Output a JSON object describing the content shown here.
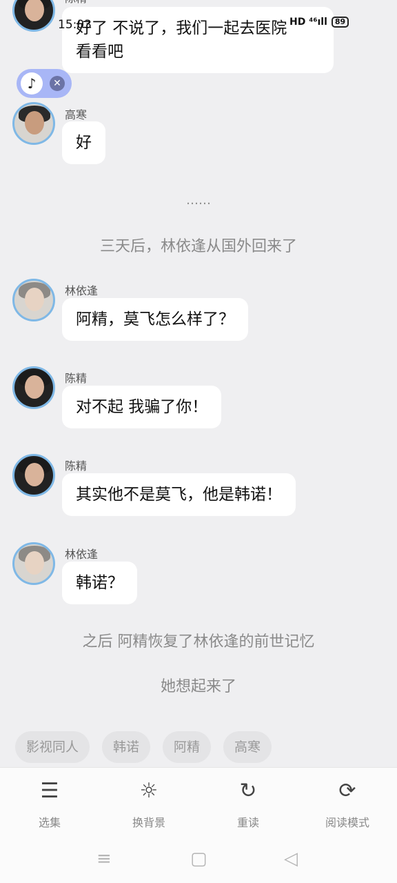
{
  "status_bar": {
    "time": "15:03",
    "network": "HD ⁴⁶ıll",
    "battery": "89"
  },
  "messages": [
    {
      "sender": "陈精",
      "text_line1": "好了 不说了，我们一起去医院",
      "text_line2": "看看吧"
    },
    {
      "sender": "高寒",
      "text": "好"
    },
    {
      "sender": "林依逢",
      "text": "阿精，莫飞怎么样了？"
    },
    {
      "sender": "陈精",
      "text": "对不起 我骗了你！"
    },
    {
      "sender": "陈精",
      "text": "其实他不是莫飞，他是韩诺！"
    },
    {
      "sender": "林依逢",
      "text": "韩诺？"
    }
  ],
  "narration": {
    "ellipsis": "……",
    "three_days": "三天后，林依逢从国外回来了",
    "memory": "之后 阿精恢复了林依逢的前世记忆",
    "recall": "她想起来了"
  },
  "tags": [
    "影视同人",
    "韩诺",
    "阿精",
    "高寒"
  ],
  "toolbar": [
    {
      "label": "选集",
      "icon": "list-icon"
    },
    {
      "label": "换背景",
      "icon": "brightness-icon"
    },
    {
      "label": "重读",
      "icon": "replay-icon"
    },
    {
      "label": "阅读模式",
      "icon": "loop-icon"
    }
  ],
  "colors": {
    "background": "#efeff1",
    "bubble": "#ffffff",
    "avatar_ring": "#7fb8e6",
    "float_widget": "#a8b6f6"
  }
}
